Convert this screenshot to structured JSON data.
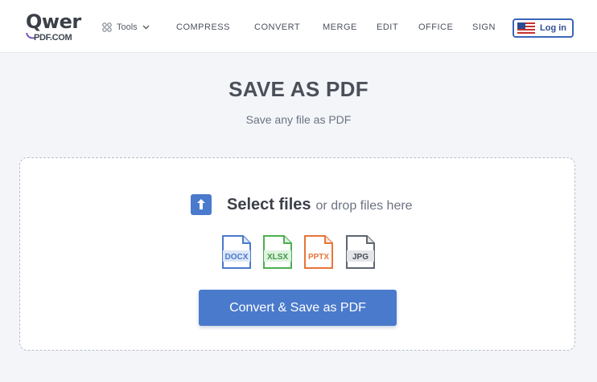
{
  "header": {
    "logo_word": "Qwer",
    "logo_sub": "PDF.COM",
    "tools_label": "Tools",
    "nav": [
      "COMPRESS",
      "CONVERT",
      "MERGE",
      "EDIT",
      "OFFICE",
      "SIGN"
    ],
    "login_label": "Log in"
  },
  "hero": {
    "title": "SAVE AS PDF",
    "subtitle": "Save any file as PDF"
  },
  "dropzone": {
    "select_label": "Select files",
    "drop_hint": "or drop files here",
    "file_types": [
      {
        "label": "DOCX",
        "color": "#4a7acb",
        "icon": "docx-file-icon"
      },
      {
        "label": "XLSX",
        "color": "#4caf50",
        "icon": "xlsx-file-icon"
      },
      {
        "label": "PPTX",
        "color": "#e8753a",
        "icon": "pptx-file-icon"
      },
      {
        "label": "JPG",
        "color": "#5f6570",
        "icon": "jpg-file-icon"
      }
    ],
    "convert_button": "Convert & Save as PDF"
  },
  "colors": {
    "accent": "#4a7acb",
    "background": "#f3f5f9"
  }
}
